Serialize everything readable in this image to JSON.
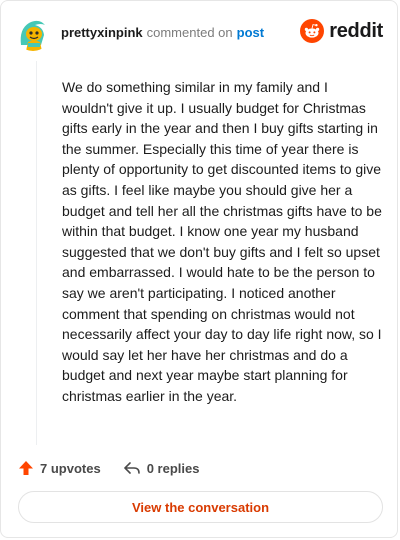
{
  "header": {
    "username": "prettyxinpink",
    "action": "commented on",
    "target": "post",
    "brand": "reddit"
  },
  "comment": {
    "body": "We do something similar in my family and I wouldn't give it up. I usually budget for Christmas gifts early in the year and then I buy gifts starting in the summer. Especially this time of year there is plenty of opportunity to get discounted items to give as gifts. I feel like maybe you should give her a budget and tell her all the christmas gifts have to be within that budget. I know one year my husband suggested that we don't buy gifts and I felt so upset and embarrassed. I would hate to be the person to say we aren't participating. I noticed another comment that spending on christmas would not necessarily affect your day to day life right now, so I would say let her have her christmas and do a budget and next year maybe start planning for christmas earlier in the year."
  },
  "footer": {
    "upvotes": "7 upvotes",
    "replies": "0 replies",
    "upvote_icon": "upvote-arrow-icon",
    "reply_icon": "reply-arrow-icon"
  },
  "cta": {
    "label": "View the conversation"
  },
  "colors": {
    "accent": "#ff4500",
    "link": "#0079d3",
    "cta_text": "#d93a00"
  }
}
